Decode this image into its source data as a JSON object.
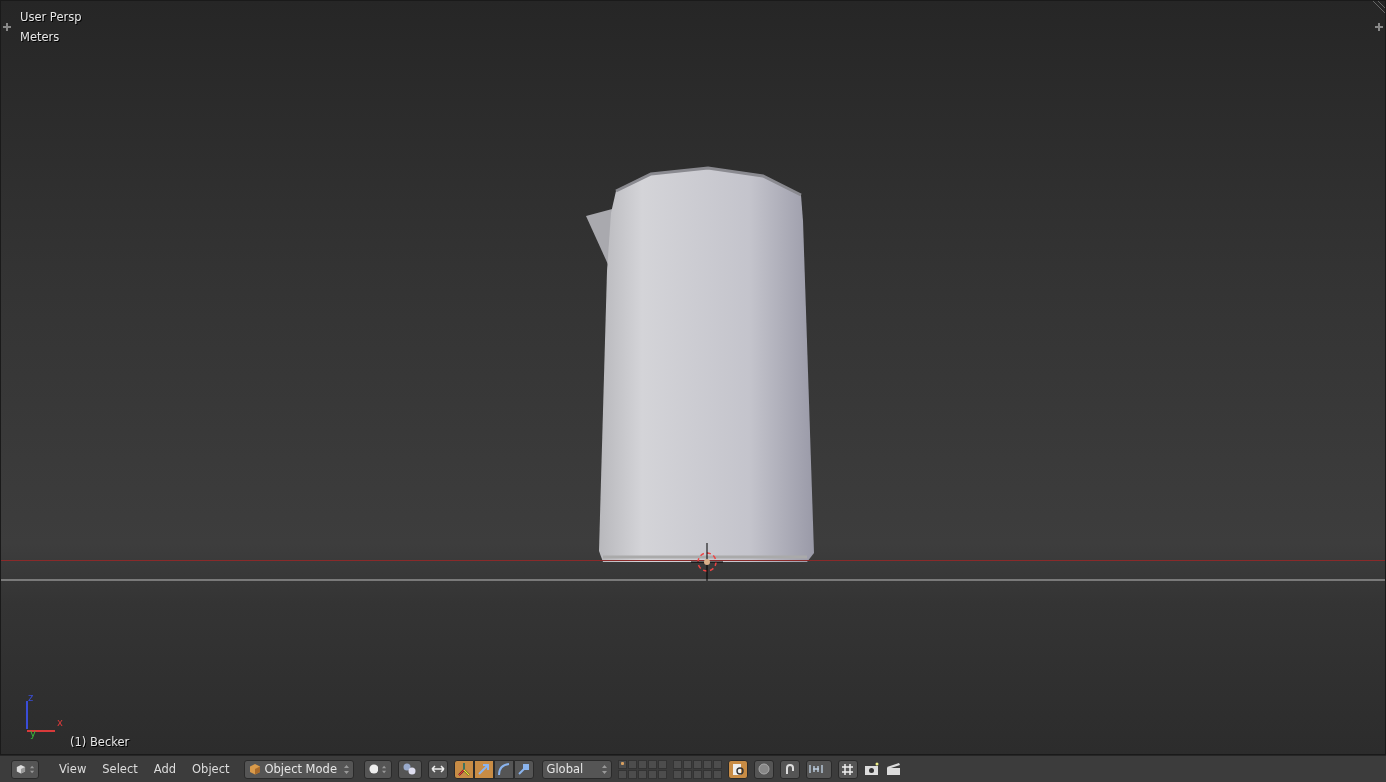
{
  "viewport": {
    "view_name": "User Persp",
    "units": "Meters",
    "object_label": "(1) Becker",
    "axes": [
      {
        "kind": "z",
        "label": "z"
      },
      {
        "kind": "x",
        "label": "x"
      },
      {
        "kind": "y",
        "label": "y"
      }
    ]
  },
  "header": {
    "menus": [
      "View",
      "Select",
      "Add",
      "Object"
    ],
    "mode": "Object Mode",
    "orientation": "Global",
    "tools": [
      {
        "kind": "manipulator",
        "selected": true
      },
      {
        "kind": "translate",
        "selected": true
      },
      {
        "kind": "rotate",
        "selected": false
      },
      {
        "kind": "scale",
        "selected": false
      }
    ],
    "layers": [
      {
        "has_object": true
      },
      {
        "has_object": false
      },
      {
        "has_object": false
      },
      {
        "has_object": false
      },
      {
        "has_object": false
      },
      {
        "has_object": false
      },
      {
        "has_object": false
      },
      {
        "has_object": false
      },
      {
        "has_object": false
      },
      {
        "has_object": false
      },
      {
        "has_object": false
      },
      {
        "has_object": false
      },
      {
        "has_object": false
      },
      {
        "has_object": false
      },
      {
        "has_object": false
      },
      {
        "has_object": false
      },
      {
        "has_object": false
      },
      {
        "has_object": false
      },
      {
        "has_object": false
      },
      {
        "has_object": false
      }
    ],
    "lock_to_scene": true
  }
}
